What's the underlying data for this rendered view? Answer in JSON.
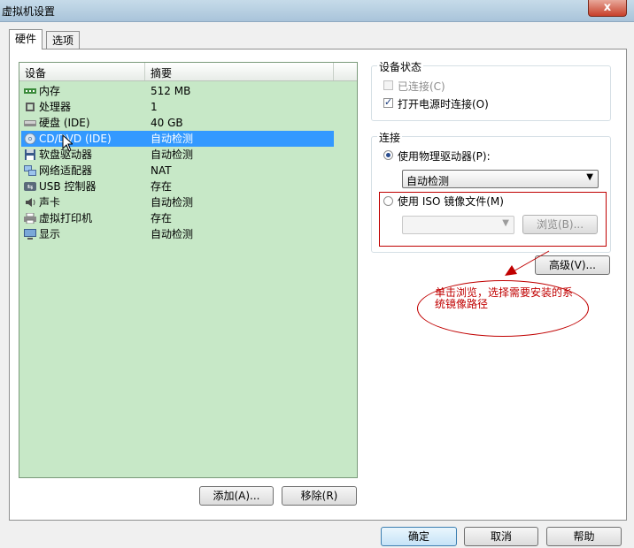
{
  "window": {
    "title": "虚拟机设置",
    "close_glyph": "x"
  },
  "tabs": [
    {
      "label": "硬件",
      "active": true
    },
    {
      "label": "选项",
      "active": false
    }
  ],
  "devices": {
    "headers": {
      "device": "设备",
      "summary": "摘要"
    },
    "rows": [
      {
        "name": "内存",
        "summary": "512 MB",
        "icon": "memory-icon"
      },
      {
        "name": "处理器",
        "summary": "1",
        "icon": "processor-icon"
      },
      {
        "name": "硬盘 (IDE)",
        "summary": "40 GB",
        "icon": "hard-disk-icon"
      },
      {
        "name": "CD/DVD (IDE)",
        "summary": "自动检测",
        "icon": "cd-dvd-icon",
        "selected": true
      },
      {
        "name": "软盘驱动器",
        "summary": "自动检测",
        "icon": "floppy-icon"
      },
      {
        "name": "网络适配器",
        "summary": "NAT",
        "icon": "network-icon"
      },
      {
        "name": "USB 控制器",
        "summary": "存在",
        "icon": "usb-icon"
      },
      {
        "name": "声卡",
        "summary": "自动检测",
        "icon": "sound-icon"
      },
      {
        "name": "虚拟打印机",
        "summary": "存在",
        "icon": "printer-icon"
      },
      {
        "name": "显示",
        "summary": "自动检测",
        "icon": "display-icon"
      }
    ]
  },
  "buttons": {
    "add": "添加(A)...",
    "remove": "移除(R)",
    "browse": "浏览(B)...",
    "advanced": "高级(V)...",
    "ok": "确定",
    "cancel": "取消",
    "help": "帮助"
  },
  "device_status": {
    "label": "设备状态",
    "connected": {
      "label": "已连接(C)",
      "checked": false,
      "disabled": true
    },
    "connect_at_power_on": {
      "label": "打开电源时连接(O)",
      "checked": true
    }
  },
  "connection": {
    "label": "连接",
    "use_physical": {
      "label": "使用物理驱动器(P):",
      "selected": true
    },
    "physical_value": "自动检测",
    "use_iso": {
      "label": "使用 ISO 镜像文件(M)",
      "selected": false
    },
    "iso_value": ""
  },
  "annotation": {
    "text": "单击浏览，选择需要安装的系统镜像路径",
    "color": "#c00000"
  }
}
